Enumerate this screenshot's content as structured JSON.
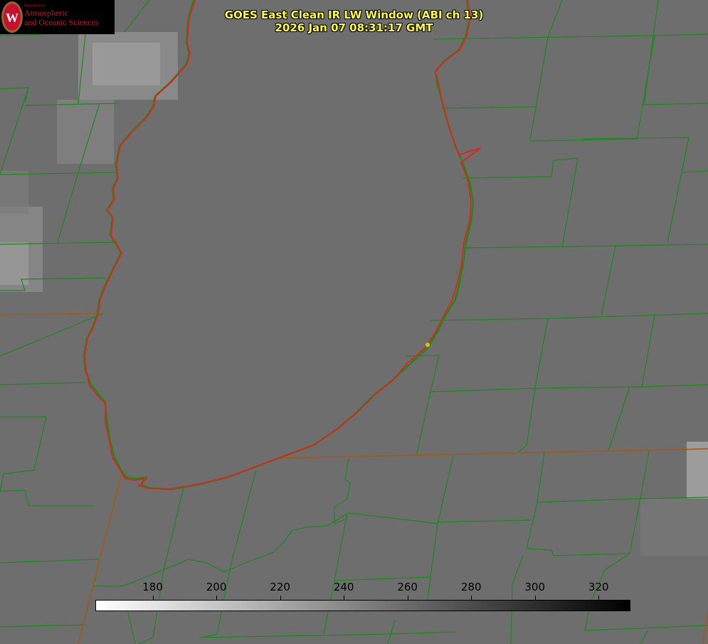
{
  "header": {
    "title_line1": "GOES East Clean IR LW Window (ABI ch 13)",
    "title_line2": "2026 Jan 07 08:31:17 GMT"
  },
  "logo": {
    "department": "Department of",
    "name_line1": "Atmospheric",
    "name_line2": "and Oceanic Sciences",
    "emblem": "W",
    "emblem_color": "#c8102e"
  },
  "colorbar": {
    "min": 162,
    "max": 330,
    "ticks": [
      "180",
      "200",
      "220",
      "240",
      "260",
      "280",
      "300",
      "320"
    ],
    "low_color": "#ffffff",
    "high_color": "#000000"
  },
  "map": {
    "background": "#6e6e6e",
    "county_line_color": "#1a8a1a",
    "coastline_color": "#e8201a",
    "state_line_color": "#a05a1a",
    "marker_color": "#d4c21c"
  }
}
